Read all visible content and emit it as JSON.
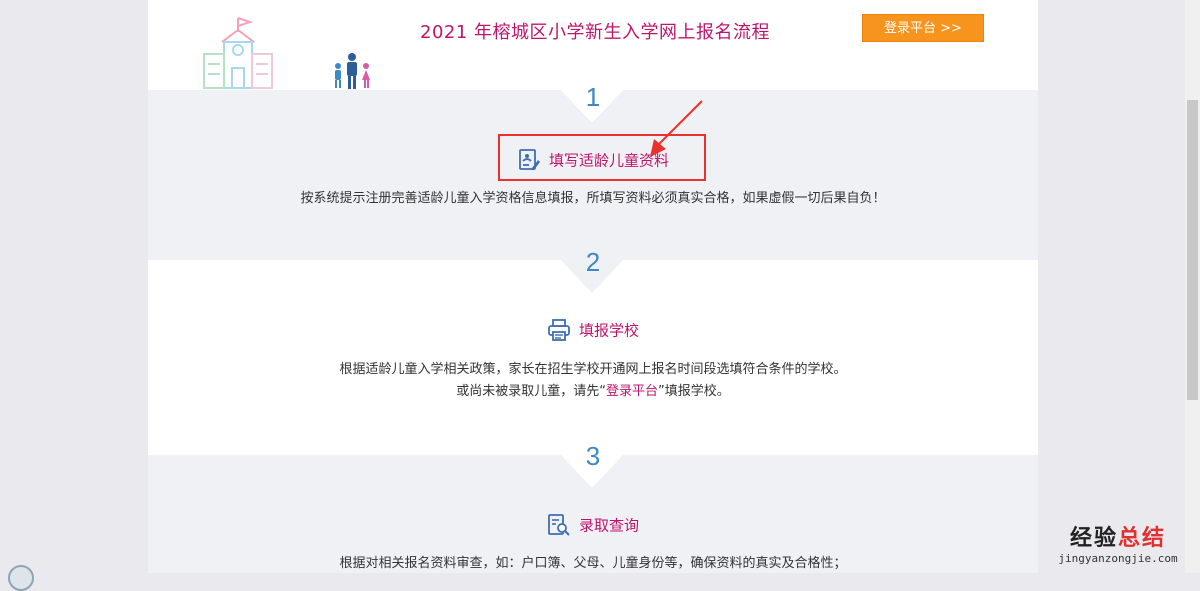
{
  "header": {
    "title": "2021 年榕城区小学新生入学网上报名流程",
    "login_label": "登录平台 >>"
  },
  "steps": [
    {
      "number": "1",
      "icon": "form-edit-icon",
      "action_label": "填写适龄儿童资料",
      "desc_line1": "按系统提示注册完善适龄儿童入学资格信息填报，所填写资料必须真实合格，如果虚假一切后果自负！"
    },
    {
      "number": "2",
      "icon": "printer-icon",
      "action_label": "填报学校",
      "desc_line1": "根据适龄儿童入学相关政策，家长在招生学校开通网上报名时间段选填符合条件的学校。",
      "desc_line2_before": "或尚未被录取儿童，请先“",
      "desc_line2_link": "登录平台",
      "desc_line2_after": "”填报学校。"
    },
    {
      "number": "3",
      "icon": "search-document-icon",
      "action_label": "录取查询",
      "desc_line1": "根据对相关报名资料审查，如：户口簿、父母、儿童身份等，确保资料的真实及合格性；"
    }
  ],
  "watermark": {
    "part1": "经验",
    "part2": "总结",
    "url": "jingyanzongjie.com"
  },
  "colors": {
    "accent": "#c0146c",
    "step_number": "#3f87c6",
    "login_button": "#f7941d",
    "highlight_box": "#e8322b",
    "gray_band": "#f0f1f5"
  }
}
